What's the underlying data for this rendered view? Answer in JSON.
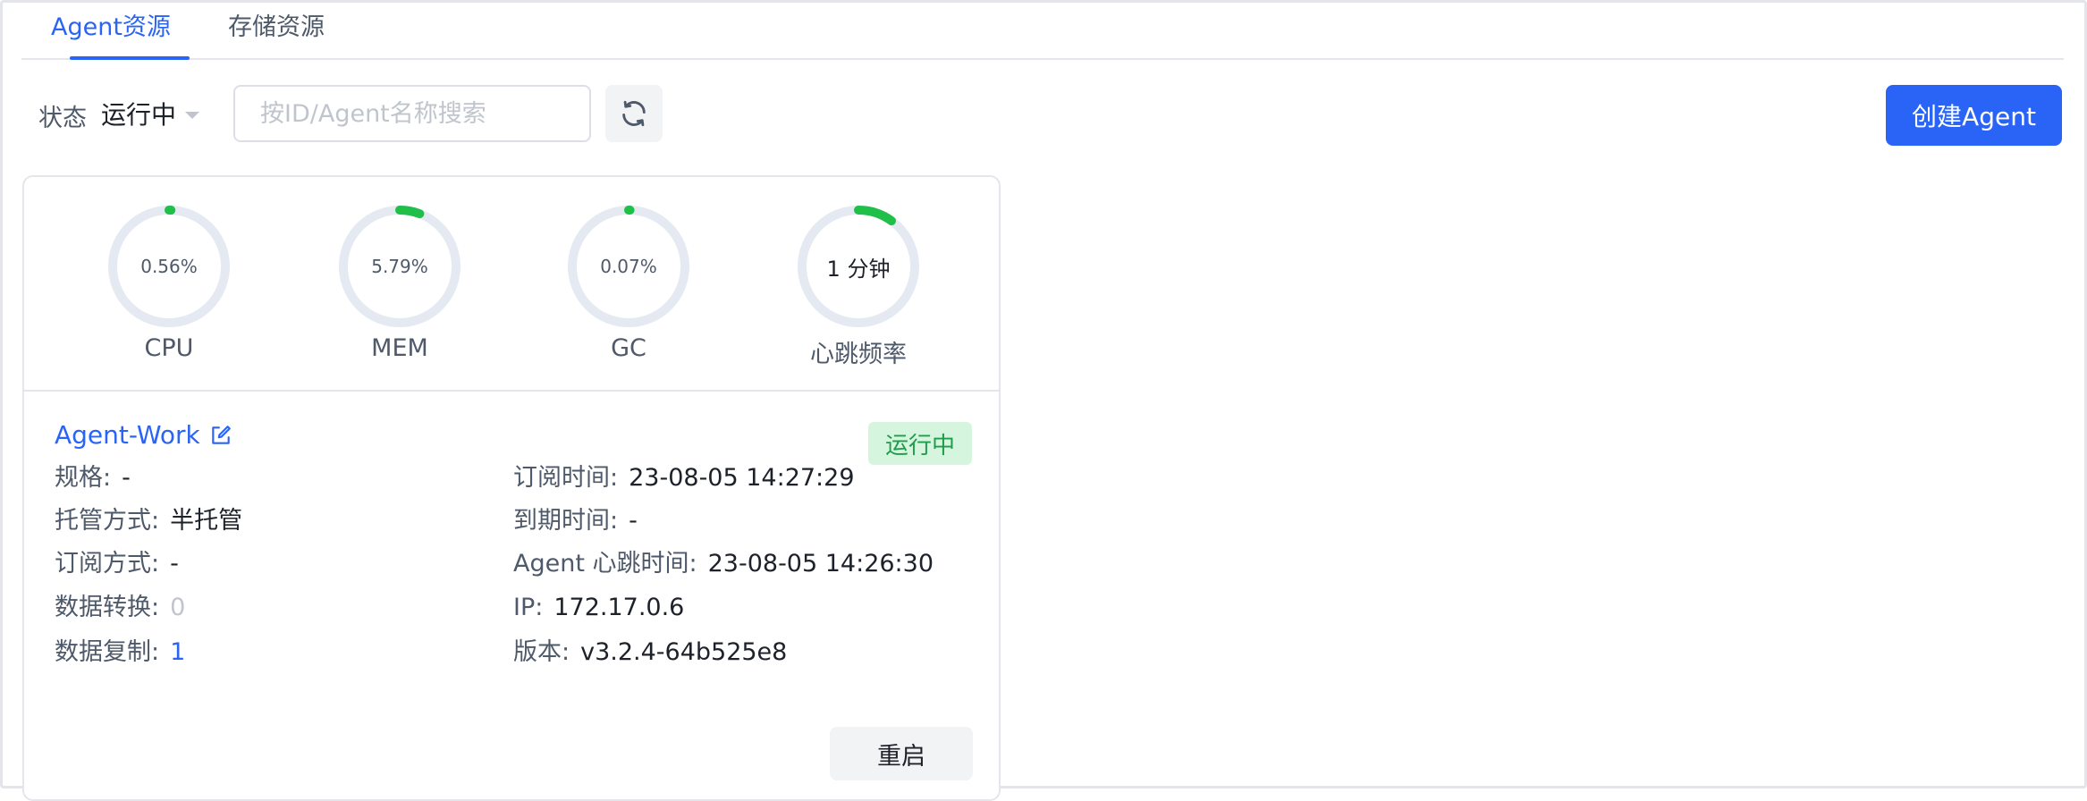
{
  "tabs": [
    {
      "label": "Agent资源",
      "active": true
    },
    {
      "label": "存储资源",
      "active": false
    }
  ],
  "toolbar": {
    "status_label": "状态",
    "status_value": "运行中",
    "search_placeholder": "按ID/Agent名称搜索",
    "create_label": "创建Agent"
  },
  "metrics": [
    {
      "value": "0.56%",
      "label": "CPU",
      "fraction": 0.0056
    },
    {
      "value": "5.79%",
      "label": "MEM",
      "fraction": 0.0579
    },
    {
      "value": "0.07%",
      "label": "GC",
      "fraction": 0.0007
    },
    {
      "value": "1 分钟",
      "label": "心跳频率",
      "fraction": 0.1
    }
  ],
  "agent": {
    "name": "Agent-Work",
    "status": "运行中",
    "spec_label": "规格:",
    "spec_value": "-",
    "hosting_label": "托管方式:",
    "hosting_value": "半托管",
    "subscribe_label": "订阅方式:",
    "subscribe_value": "-",
    "transform_label": "数据转换:",
    "transform_value": "0",
    "copy_label": "数据复制:",
    "copy_value": "1",
    "sub_time_label": "订阅时间:",
    "sub_time_value": "23-08-05 14:27:29",
    "expire_label": "到期时间:",
    "expire_value": "-",
    "heartbeat_label": "Agent 心跳时间:",
    "heartbeat_value": "23-08-05 14:26:30",
    "ip_label": "IP:",
    "ip_value": "172.17.0.6",
    "version_label": "版本:",
    "version_value": "v3.2.4-64b525e8",
    "restart_label": "重启"
  },
  "colors": {
    "primary": "#2a64f6",
    "ring_track": "#e5e9f2",
    "ring_progress": "#1fbf4a",
    "badge_bg": "#d6f5df",
    "badge_text": "#1f9e4a"
  }
}
